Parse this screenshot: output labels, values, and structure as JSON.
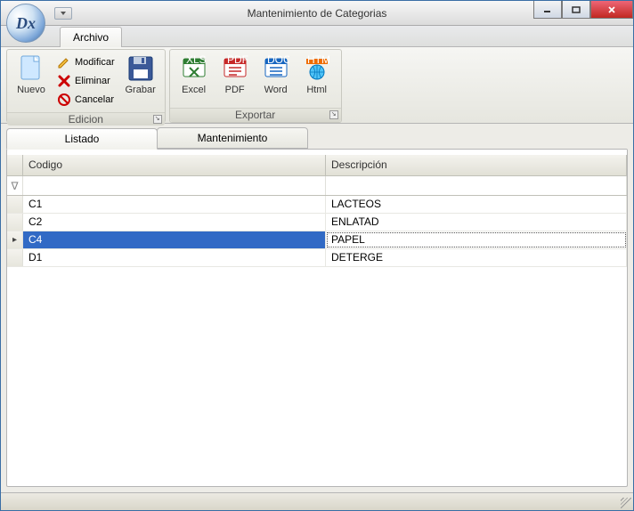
{
  "window": {
    "title": "Mantenimiento de Categorias",
    "orb_text": "Dx"
  },
  "ribbon": {
    "tab": "Archivo",
    "groups": {
      "nuevo": {
        "label": "Nuevo"
      },
      "edicion": {
        "title": "Edicion",
        "modificar": "Modificar",
        "eliminar": "Eliminar",
        "cancelar": "Cancelar",
        "grabar": "Grabar"
      },
      "exportar": {
        "title": "Exportar",
        "excel": "Excel",
        "pdf": "PDF",
        "word": "Word",
        "html": "Html"
      }
    }
  },
  "tabs": {
    "listado": "Listado",
    "mantenimiento": "Mantenimiento"
  },
  "grid": {
    "columns": {
      "codigo": "Codigo",
      "descripcion": "Descripción"
    },
    "filter_icon": "∇",
    "rows": [
      {
        "codigo": "C1",
        "descripcion": "LACTEOS",
        "selected": false
      },
      {
        "codigo": "C2",
        "descripcion": "ENLATAD",
        "selected": false
      },
      {
        "codigo": "C4",
        "descripcion": "PAPEL",
        "selected": true
      },
      {
        "codigo": "D1",
        "descripcion": "DETERGE",
        "selected": false
      }
    ]
  }
}
